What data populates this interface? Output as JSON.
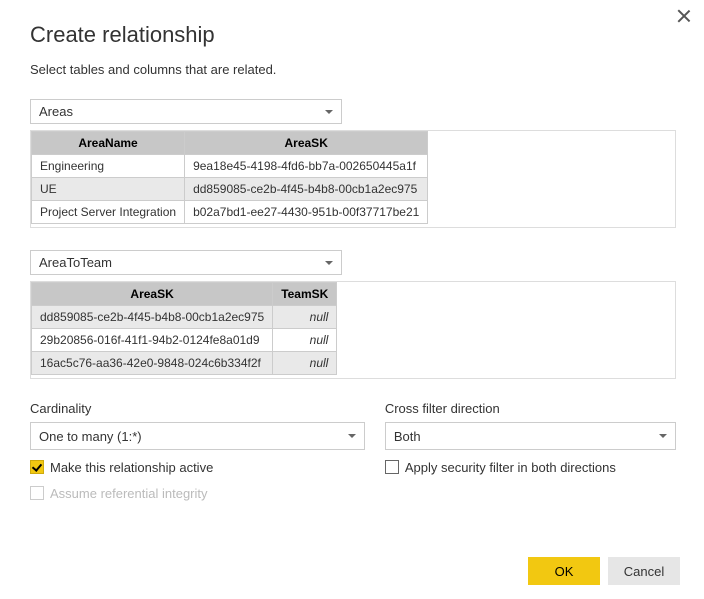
{
  "header": {
    "title": "Create relationship",
    "subtitle": "Select tables and columns that are related."
  },
  "table1": {
    "selected": "Areas",
    "columns": [
      "AreaName",
      "AreaSK"
    ],
    "rows": [
      {
        "c0": "Engineering",
        "c1": "9ea18e45-4198-4fd6-bb7a-002650445a1f"
      },
      {
        "c0": "UE",
        "c1": "dd859085-ce2b-4f45-b4b8-00cb1a2ec975"
      },
      {
        "c0": "Project Server Integration",
        "c1": "b02a7bd1-ee27-4430-951b-00f37717be21"
      }
    ]
  },
  "table2": {
    "selected": "AreaToTeam",
    "columns": [
      "AreaSK",
      "TeamSK"
    ],
    "rows": [
      {
        "c0": "dd859085-ce2b-4f45-b4b8-00cb1a2ec975",
        "c1": "null"
      },
      {
        "c0": "29b20856-016f-41f1-94b2-0124fe8a01d9",
        "c1": "null"
      },
      {
        "c0": "16ac5c76-aa36-42e0-9848-024c6b334f2f",
        "c1": "null"
      }
    ]
  },
  "cardinality": {
    "label": "Cardinality",
    "value": "One to many (1:*)"
  },
  "crossFilter": {
    "label": "Cross filter direction",
    "value": "Both"
  },
  "checkboxes": {
    "active": "Make this relationship active",
    "security": "Apply security filter in both directions",
    "referential": "Assume referential integrity"
  },
  "buttons": {
    "ok": "OK",
    "cancel": "Cancel"
  }
}
